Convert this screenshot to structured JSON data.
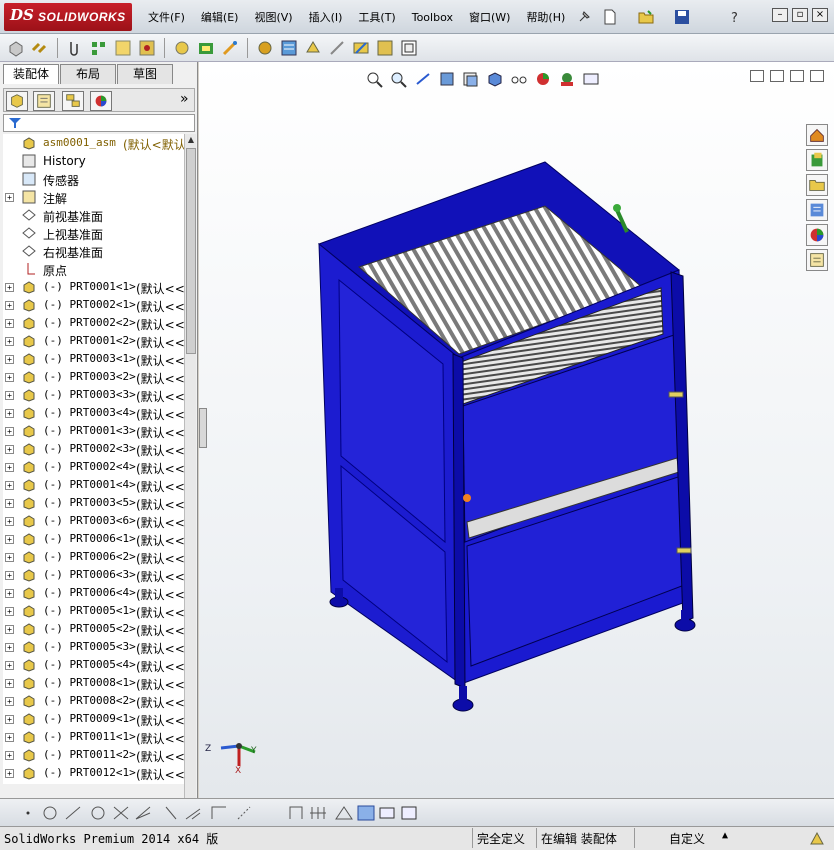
{
  "app": {
    "brand_ds": "DS",
    "brand_name": "SOLIDWORKS"
  },
  "menu": [
    "文件(F)",
    "编辑(E)",
    "视图(V)",
    "插入(I)",
    "工具(T)",
    "Toolbox",
    "窗口(W)",
    "帮助(H)"
  ],
  "panel": {
    "tabs": [
      "装配体",
      "布局",
      "草图"
    ],
    "active_tab": "装配体"
  },
  "tree": {
    "root": {
      "name": "asm0001_asm",
      "config": "(默认<默认_"
    },
    "features": [
      "History",
      "传感器",
      "注解",
      "前视基准面",
      "上视基准面",
      "右视基准面",
      "原点"
    ],
    "parts": [
      {
        "name": "(-) PRT0001<1>",
        "config": "(默认<<默"
      },
      {
        "name": "(-) PRT0002<1>",
        "config": "(默认<<默"
      },
      {
        "name": "(-) PRT0002<2>",
        "config": "(默认<<默"
      },
      {
        "name": "(-) PRT0001<2>",
        "config": "(默认<<默"
      },
      {
        "name": "(-) PRT0003<1>",
        "config": "(默认<<默"
      },
      {
        "name": "(-) PRT0003<2>",
        "config": "(默认<<默"
      },
      {
        "name": "(-) PRT0003<3>",
        "config": "(默认<<默"
      },
      {
        "name": "(-) PRT0003<4>",
        "config": "(默认<<默"
      },
      {
        "name": "(-) PRT0001<3>",
        "config": "(默认<<默"
      },
      {
        "name": "(-) PRT0002<3>",
        "config": "(默认<<默"
      },
      {
        "name": "(-) PRT0002<4>",
        "config": "(默认<<默"
      },
      {
        "name": "(-) PRT0001<4>",
        "config": "(默认<<默"
      },
      {
        "name": "(-) PRT0003<5>",
        "config": "(默认<<默"
      },
      {
        "name": "(-) PRT0003<6>",
        "config": "(默认<<默"
      },
      {
        "name": "(-) PRT0006<1>",
        "config": "(默认<<默"
      },
      {
        "name": "(-) PRT0006<2>",
        "config": "(默认<<默"
      },
      {
        "name": "(-) PRT0006<3>",
        "config": "(默认<<默"
      },
      {
        "name": "(-) PRT0006<4>",
        "config": "(默认<<默"
      },
      {
        "name": "(-) PRT0005<1>",
        "config": "(默认<<默"
      },
      {
        "name": "(-) PRT0005<2>",
        "config": "(默认<<默"
      },
      {
        "name": "(-) PRT0005<3>",
        "config": "(默认<<默"
      },
      {
        "name": "(-) PRT0005<4>",
        "config": "(默认<<默"
      },
      {
        "name": "(-) PRT0008<1>",
        "config": "(默认<<默"
      },
      {
        "name": "(-) PRT0008<2>",
        "config": "(默认<<默"
      },
      {
        "name": "(-) PRT0009<1>",
        "config": "(默认<<默"
      },
      {
        "name": "(-) PRT0011<1>",
        "config": "(默认<<默"
      },
      {
        "name": "(-) PRT0011<2>",
        "config": "(默认<<默"
      },
      {
        "name": "(-) PRT0012<1>",
        "config": "(默认<<默"
      }
    ]
  },
  "triad": {
    "x": "X",
    "y": "Y",
    "z": "Z"
  },
  "status": {
    "product": "SolidWorks Premium 2014 x64 版",
    "definition": "完全定义",
    "editing": "在编辑 装配体",
    "units": "自定义"
  },
  "colors": {
    "model_blue": "#1a1ad0",
    "frame_blue": "#0c0ca8",
    "brand_red": "#c8202a"
  }
}
